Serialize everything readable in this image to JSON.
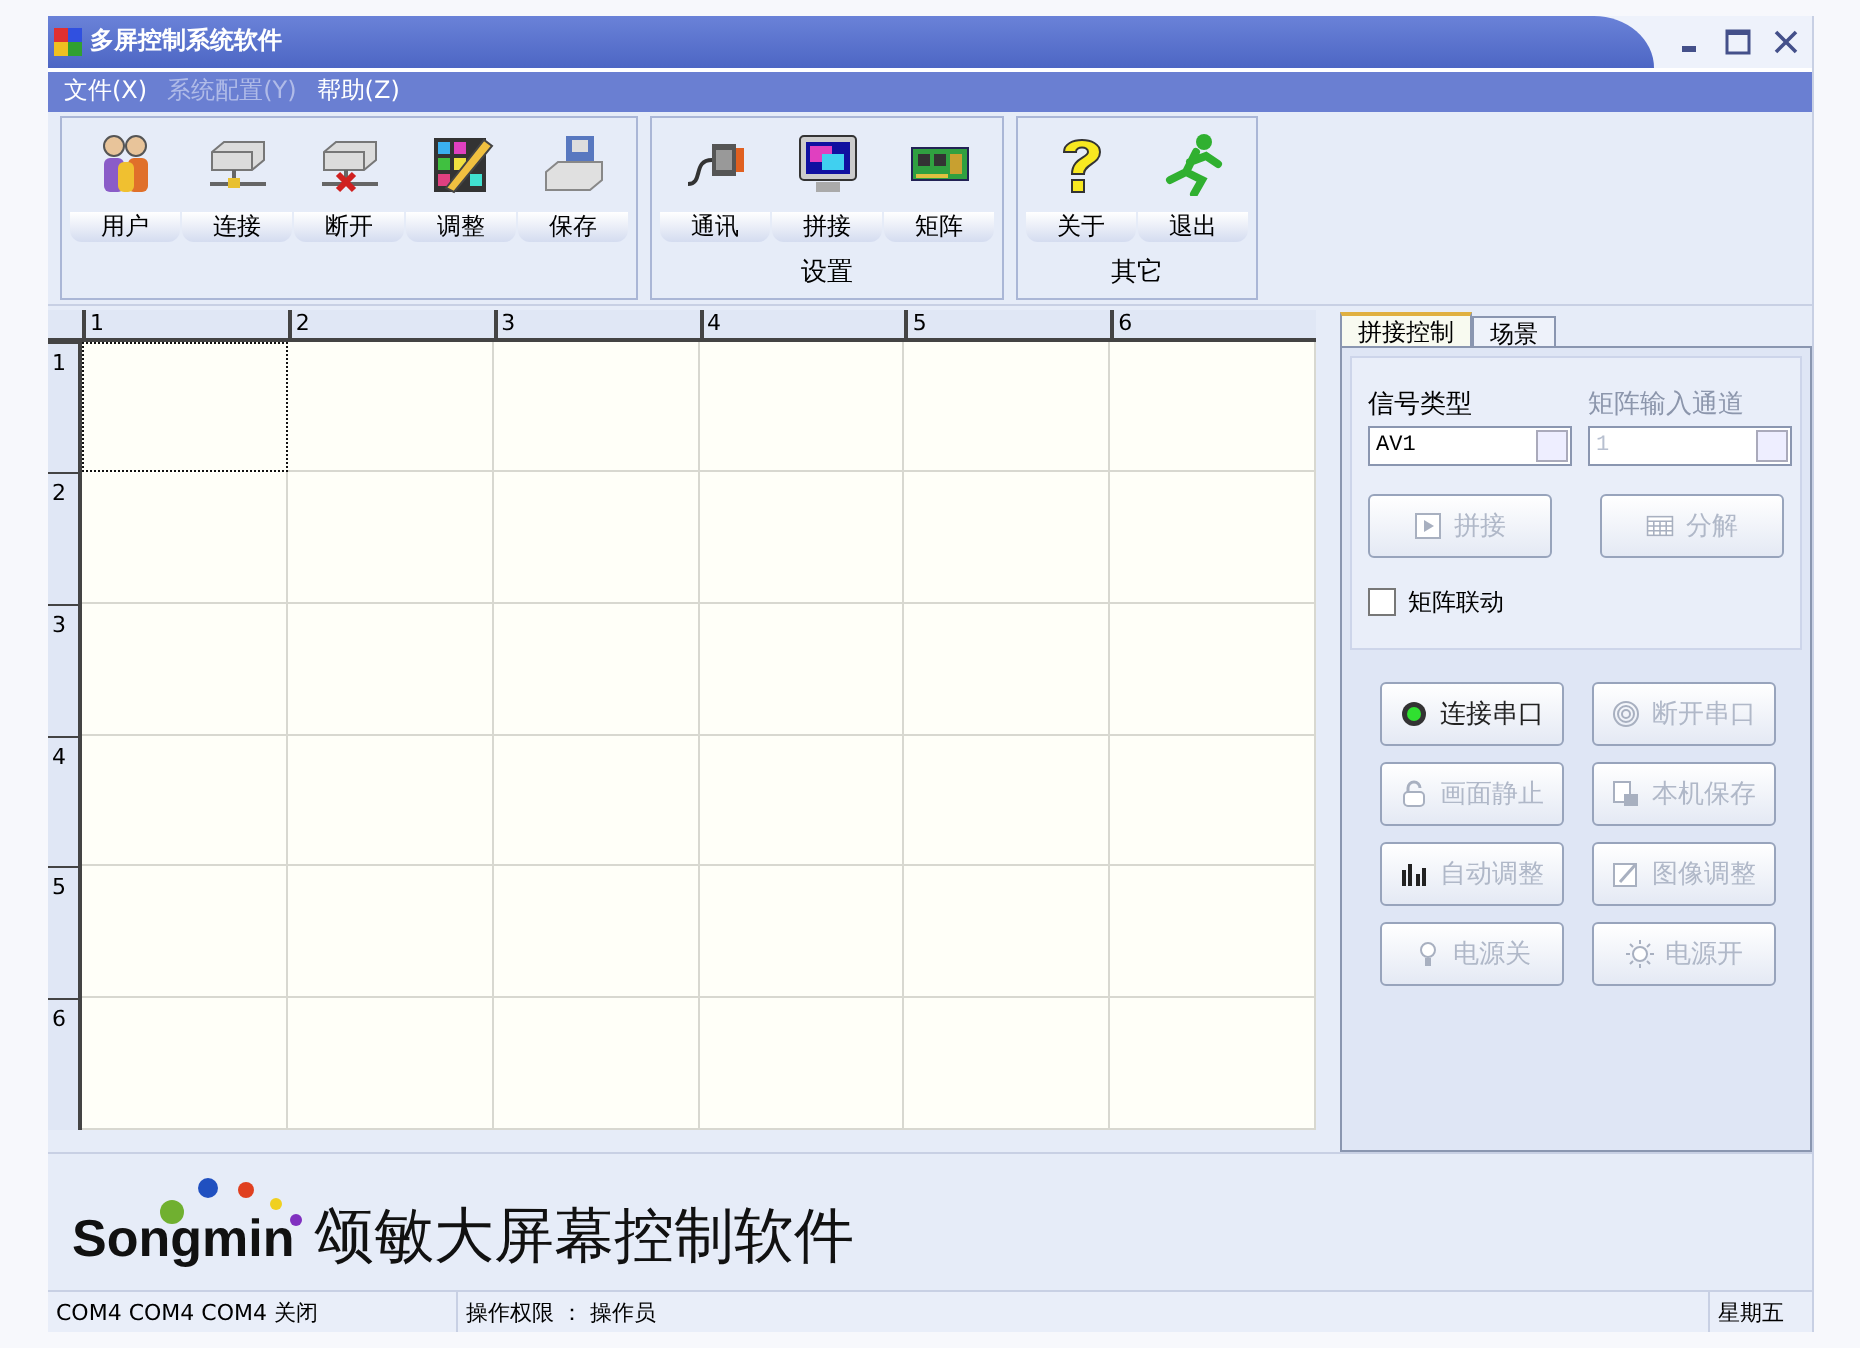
{
  "window": {
    "title": "多屏控制系统软件"
  },
  "menu": [
    {
      "label": "文件(X)",
      "disabled": false
    },
    {
      "label": "系统配置(Y)",
      "disabled": true
    },
    {
      "label": "帮助(Z)",
      "disabled": false
    }
  ],
  "toolbar_groups": [
    {
      "buttons": [
        {
          "kind": "users",
          "label": "用户"
        },
        {
          "kind": "connect",
          "label": "连接"
        },
        {
          "kind": "disconnect",
          "label": "断开"
        },
        {
          "kind": "adjust",
          "label": "调整"
        },
        {
          "kind": "save",
          "label": "保存"
        }
      ]
    },
    {
      "caption": "设置",
      "buttons": [
        {
          "kind": "comm",
          "label": "通讯"
        },
        {
          "kind": "splice",
          "label": "拼接"
        },
        {
          "kind": "matrix",
          "label": "矩阵"
        }
      ]
    },
    {
      "caption": "其它",
      "buttons": [
        {
          "kind": "about",
          "label": "关于"
        },
        {
          "kind": "exit",
          "label": "退出"
        }
      ]
    }
  ],
  "grid": {
    "columns": [
      "1",
      "2",
      "3",
      "4",
      "5",
      "6"
    ],
    "rows": [
      {
        "label": "1",
        "cells": [
          {
            "selected": true
          },
          {
            "selected": false
          },
          {
            "selected": false
          },
          {
            "selected": false
          },
          {
            "selected": false
          },
          {
            "selected": false
          }
        ]
      },
      {
        "label": "2",
        "cells": [
          {
            "selected": false
          },
          {
            "selected": false
          },
          {
            "selected": false
          },
          {
            "selected": false
          },
          {
            "selected": false
          },
          {
            "selected": false
          }
        ]
      },
      {
        "label": "3",
        "cells": [
          {
            "selected": false
          },
          {
            "selected": false
          },
          {
            "selected": false
          },
          {
            "selected": false
          },
          {
            "selected": false
          },
          {
            "selected": false
          }
        ]
      },
      {
        "label": "4",
        "cells": [
          {
            "selected": false
          },
          {
            "selected": false
          },
          {
            "selected": false
          },
          {
            "selected": false
          },
          {
            "selected": false
          },
          {
            "selected": false
          }
        ]
      },
      {
        "label": "5",
        "cells": [
          {
            "selected": false
          },
          {
            "selected": false
          },
          {
            "selected": false
          },
          {
            "selected": false
          },
          {
            "selected": false
          },
          {
            "selected": false
          }
        ]
      },
      {
        "label": "6",
        "cells": [
          {
            "selected": false
          },
          {
            "selected": false
          },
          {
            "selected": false
          },
          {
            "selected": false
          },
          {
            "selected": false
          },
          {
            "selected": false
          }
        ]
      }
    ]
  },
  "side_tabs": [
    {
      "label": "拼接控制",
      "selected": true
    },
    {
      "label": "场景",
      "selected": false
    }
  ],
  "fields": [
    {
      "label": "信号类型",
      "value": "AV1",
      "disabled": false
    },
    {
      "label": "矩阵输入通道",
      "value": "1",
      "disabled": true
    }
  ],
  "splice_buttons": [
    {
      "kind": "play",
      "label": "拼接",
      "disabled": true
    },
    {
      "kind": "calendar",
      "label": "分解",
      "disabled": true
    }
  ],
  "checkbox": {
    "label": "矩阵联动",
    "checked": false
  },
  "control_buttons": [
    {
      "kind": "led",
      "label": "连接串口",
      "disabled": false
    },
    {
      "kind": "rings",
      "label": "断开串口",
      "disabled": true
    },
    {
      "kind": "lock",
      "label": "画面静止",
      "disabled": true
    },
    {
      "kind": "docsave",
      "label": "本机保存",
      "disabled": true
    },
    {
      "kind": "bars",
      "label": "自动调整",
      "disabled": true
    },
    {
      "kind": "imageedit",
      "label": "图像调整",
      "disabled": true
    },
    {
      "kind": "bulb",
      "label": "电源关",
      "disabled": true
    },
    {
      "kind": "sun",
      "label": "电源开",
      "disabled": true
    }
  ],
  "logo": {
    "brand": "Songmin",
    "caption": "颂敏大屏幕控制软件"
  },
  "status_bar": [
    "COM4 COM4 COM4 关闭",
    "操作权限 ： 操作员",
    "星期五"
  ]
}
